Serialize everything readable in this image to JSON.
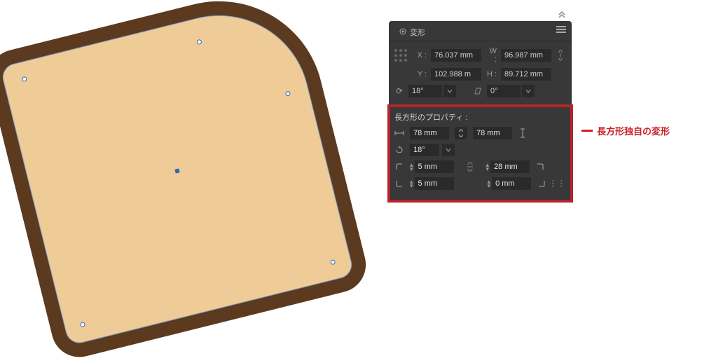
{
  "panel": {
    "title": "変形",
    "x_label": "X :",
    "y_label": "Y :",
    "w_label": "W :",
    "h_label": "H :",
    "x_value": "76.037 mm",
    "y_value": "102.988 m",
    "w_value": "96.987 mm",
    "h_value": "89.712 mm",
    "rotate_value": "18°",
    "shear_value": "0°"
  },
  "rect": {
    "title": "長方形のプロパティ :",
    "width": "78 mm",
    "height": "78 mm",
    "angle": "18°",
    "corner_tl": "5 mm",
    "corner_tr": "28 mm",
    "corner_bl": "5 mm",
    "corner_br": "0 mm"
  },
  "callout": {
    "text": "長方形独自の変形"
  }
}
